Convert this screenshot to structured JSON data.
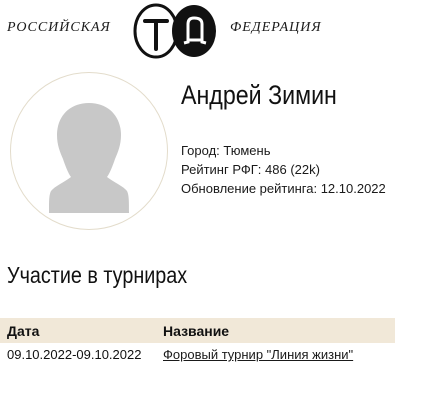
{
  "header": {
    "left_text": "Российская",
    "right_text": "Федерация",
    "logo_icon": "gto-logo-icon"
  },
  "profile": {
    "avatar_icon": "person-silhouette-icon",
    "name": "Андрей Зимин",
    "city": "Город: Тюмень",
    "rating": "Рейтинг РФГ: 486 (22k)",
    "rating_update": "Обновление рейтинга: 12.10.2022"
  },
  "tournaments": {
    "title": "Участие в турнирах",
    "columns": [
      "Дата",
      "Название"
    ],
    "rows": [
      {
        "date": "09.10.2022-09.10.2022",
        "name": "Форовый турнир \"Линия жизни\""
      }
    ]
  },
  "colors": {
    "table_header_bg": "#f1e8d8",
    "avatar_border": "#e3dccb",
    "silhouette": "#c8c8c8"
  }
}
